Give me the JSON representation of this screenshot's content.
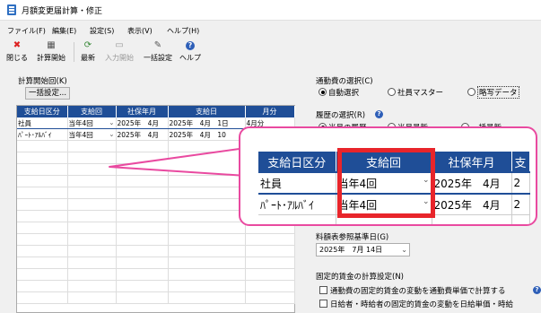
{
  "window": {
    "title": "月額変更届計算・修正"
  },
  "menu": [
    {
      "label": "ファイル(F)"
    },
    {
      "label": "編集(E)"
    },
    {
      "label": "設定(S)"
    },
    {
      "label": "表示(V)"
    },
    {
      "label": "ヘルプ(H)"
    }
  ],
  "toolbar": {
    "close": "閉じる",
    "calc_start": "計算開始",
    "refresh": "最新",
    "input_start": "入力開始",
    "bulk_set": "一括設定",
    "help": "ヘルプ"
  },
  "left": {
    "calc_start_label": "計算開始回(K)",
    "bulk_button": "一括設定...",
    "columns": [
      "支給日区分",
      "支給回",
      "社保年月",
      "支給日",
      "月分"
    ],
    "rows": [
      {
        "kubun": "社員",
        "kai": "当年4回",
        "nengetsu": "2025年　4月",
        "date": "2025年　4月　1日",
        "tsuki": "4月分"
      },
      {
        "kubun": "ﾊﾟｰﾄ･ｱﾙﾊﾞｲ",
        "kai": "当年4回",
        "nengetsu": "2025年　4月",
        "date": "2025年　4月　10",
        "tsuki": ""
      }
    ]
  },
  "right": {
    "commute_label": "通勤費の選択(C)",
    "commute_options": [
      "自動選択",
      "社員マスター",
      "略写データ"
    ],
    "commute_selected": 0,
    "history_label": "履歴の選択(R)",
    "history_options": [
      "当月の履歴",
      "当月最新",
      "一括最新"
    ],
    "pay_table_label": "料額表参照基準日(G)",
    "pay_table_date": "2025年　7月 14日",
    "fixed_wage_label": "固定的賃金の計算設定(N)",
    "check1": "通勤費の固定的賃金の変動を通勤費単価で計算する",
    "check2": "日給者・時給者の固定的賃金の変動を日給単価・時給"
  },
  "zoom": {
    "columns": [
      "支給日区分",
      "支給回",
      "社保年月",
      "支"
    ],
    "rows": [
      {
        "kubun": "社員",
        "kai": "当年4回",
        "nengetsu": "2025年　4月",
        "extra": "2"
      },
      {
        "kubun": "ﾊﾟｰﾄ･ｱﾙﾊﾞｲ",
        "kai": "当年4回",
        "nengetsu": "2025年　4月",
        "extra": "2"
      }
    ]
  },
  "colors": {
    "header_blue": "#1f4e97",
    "callout_pink": "#e94aa0",
    "highlight_red": "#e8252b"
  }
}
